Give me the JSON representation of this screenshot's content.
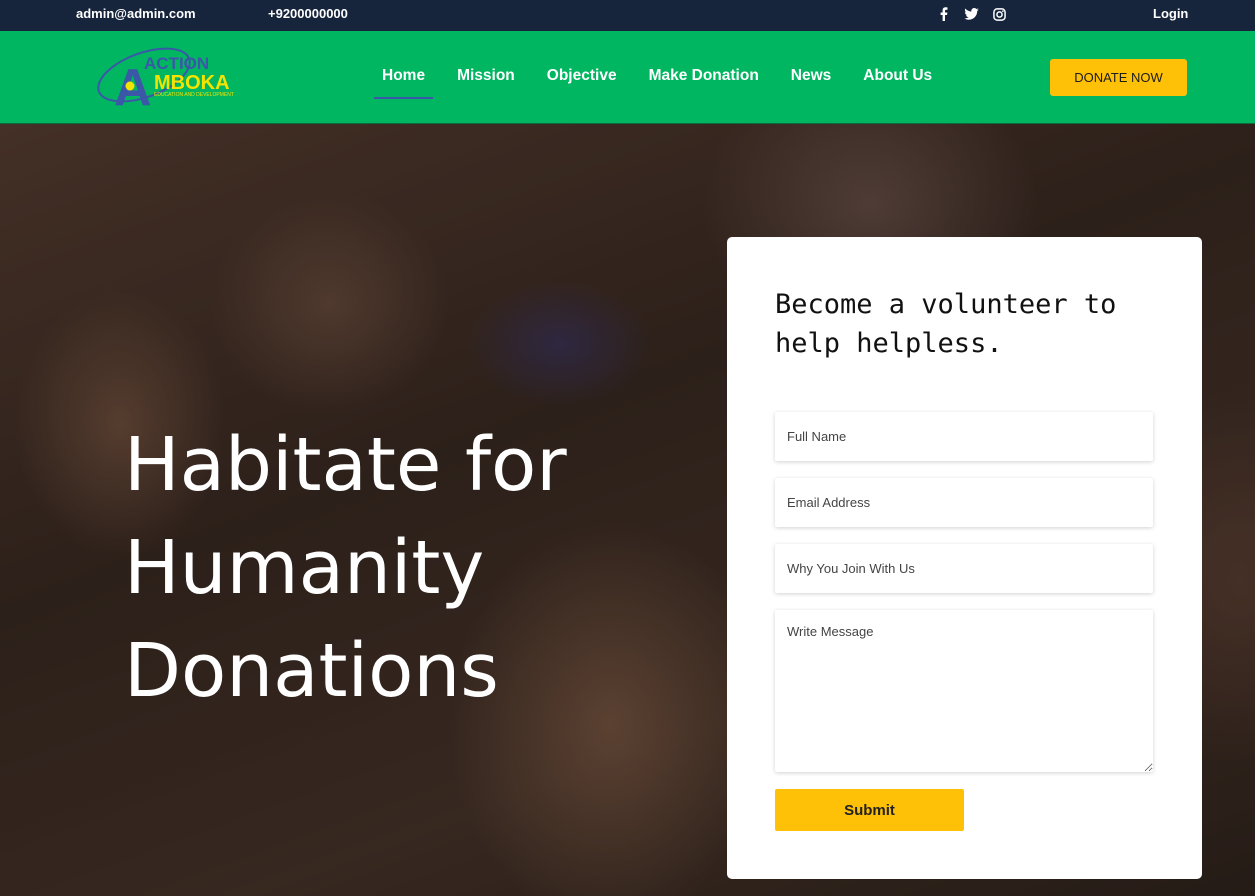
{
  "topbar": {
    "email": "admin@admin.com",
    "phone": "+9200000000",
    "social_icons": [
      "facebook-icon",
      "twitter-icon",
      "instagram-icon"
    ],
    "login": "Login"
  },
  "brand": {
    "logo_line1": "ACTION",
    "logo_line2": "MBOKA",
    "logo_letter": "A",
    "logo_tagline": "EDUCATION AND DEVELOPMENT"
  },
  "nav": {
    "items": [
      "Home",
      "Mission",
      "Objective",
      "Make Donation",
      "News",
      "About Us"
    ],
    "active": "Home",
    "donate_label": "DONATE NOW"
  },
  "hero": {
    "title_line1": "Habitate for",
    "title_line2": "Humanity",
    "title_line3": "Donations"
  },
  "form": {
    "heading": "Become a volunteer to help helpless.",
    "full_name_placeholder": "Full Name",
    "email_placeholder": "Email Address",
    "reason_placeholder": "Why You Join With Us",
    "message_placeholder": "Write Message",
    "submit_label": "Submit"
  },
  "colors": {
    "topbar_bg": "#17253c",
    "navbar_bg": "#00b661",
    "accent_yellow": "#ffc107",
    "active_underline": "#3b57a8"
  }
}
